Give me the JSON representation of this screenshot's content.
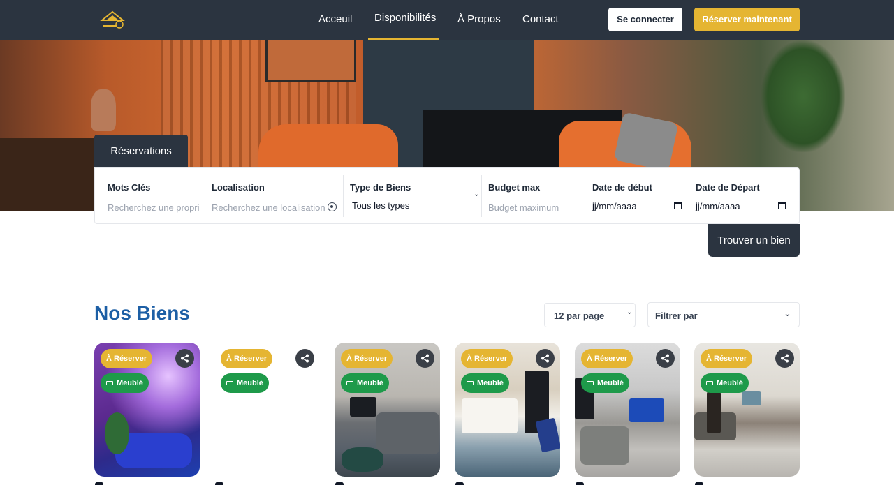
{
  "nav": {
    "logo_alt": "logo",
    "items": [
      "Acceuil",
      "Disponibilités",
      "À Propos",
      "Contact"
    ],
    "active_index": 1,
    "login_label": "Se connecter",
    "book_label": "Réserver maintenant",
    "accent_color": "#e5b532"
  },
  "search": {
    "tab_label": "Réservations",
    "keywords_label": "Mots Clés",
    "keywords_placeholder": "Recherchez une propriété",
    "location_label": "Localisation",
    "location_placeholder": "Recherchez une localisation",
    "type_label": "Type de Biens",
    "type_value": "Tous les types",
    "budget_label": "Budget max",
    "budget_placeholder": "Budget maximum",
    "start_label": "Date de début",
    "start_value": "jj/mm/aaaa",
    "end_label": "Date de Départ",
    "end_value": "jj/mm/aaaa",
    "find_label": "Trouver un bien"
  },
  "listing": {
    "title": "Nos Biens",
    "title_color": "#1d5fa5",
    "per_page": "12 par page",
    "filter_label": "Filtrer par",
    "cards": [
      {
        "status": "À Réserver",
        "tag": "Meublé",
        "has_image": true
      },
      {
        "status": "À Réserver",
        "tag": "Meublé",
        "has_image": false
      },
      {
        "status": "À Réserver",
        "tag": "Meublé",
        "has_image": true
      },
      {
        "status": "À Réserver",
        "tag": "Meublé",
        "has_image": true
      },
      {
        "status": "À Réserver",
        "tag": "Meublé",
        "has_image": true
      },
      {
        "status": "À Réserver",
        "tag": "Meublé",
        "has_image": true
      }
    ]
  }
}
